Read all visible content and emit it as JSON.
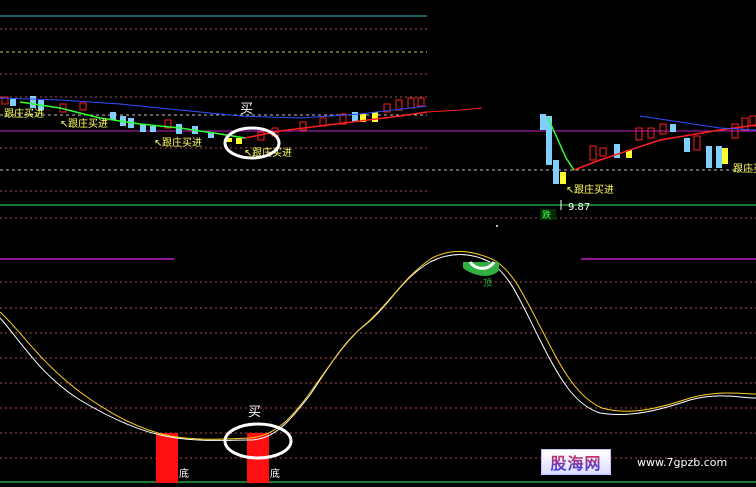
{
  "colors": {
    "background": "#000000",
    "grid_dotted": "#b05050",
    "cyan_line": "#40c0c0",
    "white_dash": "#c0c0c0",
    "purple_line": "#c020c0",
    "green_line": "#20a040",
    "candle_up": "#ff2020",
    "candle_down": "#80d0ff",
    "candle_yellow": "#ffff30",
    "ma_red": "#ff2020",
    "ma_green": "#30ff30",
    "ma_blue": "#3050ff",
    "osc_white": "#ffffff",
    "osc_yellow": "#ffd020",
    "bottom_bar": "#ff1010",
    "buy_circle": "#ffffff",
    "annotation_text": "#ffff60"
  },
  "upper_panel": {
    "buy_label": "买",
    "follow_label_1": "跟庄买进",
    "follow_label_2": "跟庄买进",
    "follow_label_3": "跟庄买进",
    "follow_label_4": "跟庄买进",
    "follow_label_5": "跟庄买进",
    "follow_label_6": "跟庄买进",
    "low_price": "9.87",
    "drop_label": "跌",
    "icons": [
      "arrow-pointer-icon",
      "circle-highlight-icon"
    ]
  },
  "lower_panel": {
    "buy_label": "买",
    "bottom_label_1": "底",
    "bottom_label_2": "底",
    "top_label": "顶"
  },
  "watermark": {
    "brand": "股海网",
    "url": "www.7gpzb.com"
  }
}
